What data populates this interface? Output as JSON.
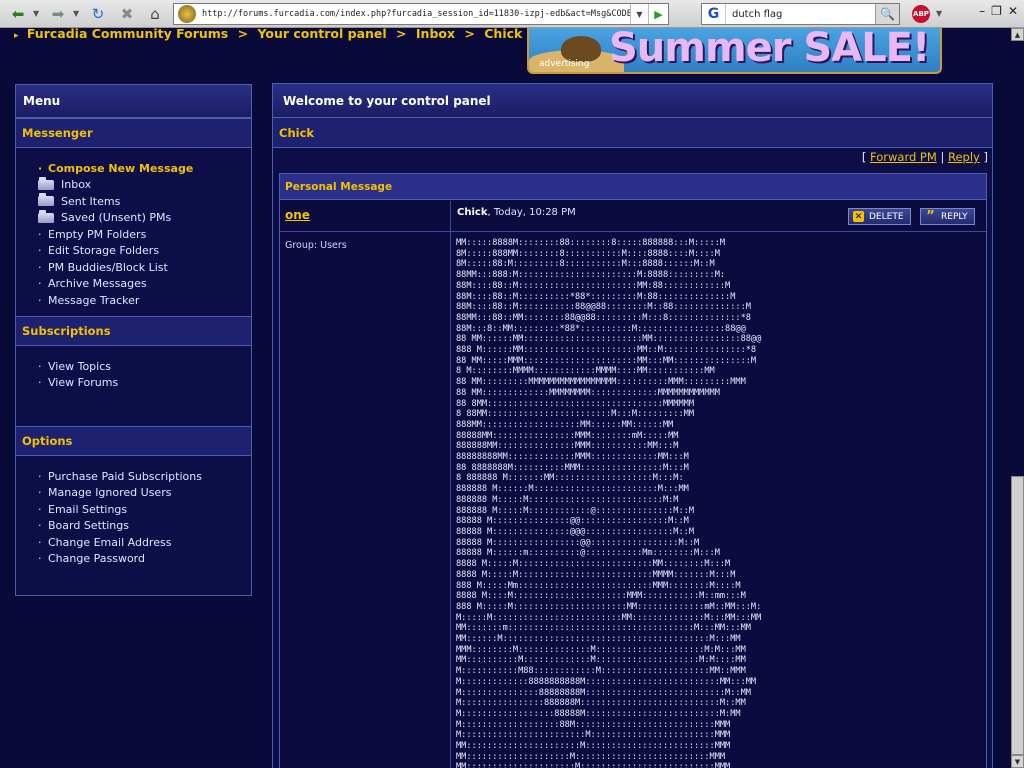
{
  "browser": {
    "url": "http://forums.furcadia.com/index.php?furcadia_session_id=11830-izpj-edb&act=Msg&CODE=",
    "search_value": "dutch flag",
    "search_engine_glyph": "G",
    "abp_label": "ABP"
  },
  "breadcrumb": [
    "Furcadia Community Forums",
    "Your control panel",
    "Inbox",
    "Chick"
  ],
  "breadcrumb_sep": ">",
  "banner": {
    "text": "Summer SALE!",
    "label": "advertising"
  },
  "sidebar": {
    "title": "Menu",
    "sections": [
      {
        "title": "Messenger",
        "items": [
          {
            "label": "Compose New Message",
            "type": "compose"
          },
          {
            "label": "Inbox",
            "type": "folder"
          },
          {
            "label": "Sent Items",
            "type": "folder"
          },
          {
            "label": "Saved (Unsent) PMs",
            "type": "folder"
          },
          {
            "label": "Empty PM Folders",
            "type": "link"
          },
          {
            "label": "Edit Storage Folders",
            "type": "link"
          },
          {
            "label": "PM Buddies/Block List",
            "type": "link"
          },
          {
            "label": "Archive Messages",
            "type": "link"
          },
          {
            "label": "Message Tracker",
            "type": "link"
          }
        ]
      },
      {
        "title": "Subscriptions",
        "items": [
          {
            "label": "View Topics",
            "type": "link"
          },
          {
            "label": "View Forums",
            "type": "link"
          }
        ]
      },
      {
        "title": "Options",
        "items": [
          {
            "label": "Purchase Paid Subscriptions",
            "type": "link"
          },
          {
            "label": "Manage Ignored Users",
            "type": "link"
          },
          {
            "label": "Email Settings",
            "type": "link"
          },
          {
            "label": "Board Settings",
            "type": "link"
          },
          {
            "label": "Change Email Address",
            "type": "link"
          },
          {
            "label": "Change Password",
            "type": "link"
          }
        ]
      }
    ]
  },
  "main": {
    "title": "Welcome to your control panel",
    "subtitle": "Chick",
    "actions": {
      "open": "[",
      "forward": "Forward PM",
      "sep": "|",
      "reply": "Reply",
      "close": "]"
    },
    "pm": {
      "box_title": "Personal Message",
      "author": "one",
      "from": "Chick",
      "date": ", Today, 10:28 PM",
      "delete_label": "DELETE",
      "reply_label": "REPLY",
      "group": "Group: Users",
      "body": "MM:::::8888M::::::::88::::::::8:::::888888:::M:::::M\n8M:::::888MM::::::::8:::::::::::M::::8888::::M::::M\n8M:::::88:M:::::::::8:::::::::::M:::8888::::::M::M\n88MM:::888:M:::::::::::::::::::::::M:8888:::::::::M:\n88M::::88::M:::::::::::::::::::::::MM:88::::::::::::M\n88M::::88::M::::::::::*88*:::::::::M:88::::::::::::::M\n88M::::88::M:::::::::::88@@88::::::::M::88::::::::::::::M\n88MM:::88::MM::::::::88@@88:::::::::M:::8::::::::::::::*8\n88M:::8::MM:::::::::*88*::::::::::M:::::::::::::::::88@@\n88 MM::::::MM:::::::::::::::::::::::MM:::::::::::::::::88@@\n888 M::::::MM::::::::::::::::::::::MM::M::::::::::::::::*8\n88 MM:::::MMM::::::::::::::::::::::MM:::MM:::::::::::::::M\n8 M::::::::MMMM::::::::::::MMMM::::MM:::::::::::MM\n88 MM:::::::::MMMMMMMMMMMMMMMMM::::::::::MMM:::::::::MMM\n88 MM:::::::::::::MMMMMMMM:::::::::::::MMMMMMMMMMMM\n88 8MM::::::::::::::::::::::::::::::::::MMMMMM\n8 88MM::::::::::::::::::::::::M:::M:::::::::MM\n888MM:::::::::::::::::::MM::::::MM::::::MM\n88888MM::::::::::::::::MMM::::::::mM:::::MM\n888888MM:::::::::::::::MMM:::::::::::MM:::M\n88888888MM:::::::::::::MMM:::::::::::::MM:::M\n88 8888888M::::::::::MMM::::::::::::::::M:::M\n8 888888 M:::::::MM:::::::::::::::::::M:::M:\n888888 M::::::M::::::::::::::::::::::::M:::MM\n888888 M:::::M::::::::::::::::::::::::::M:M\n888888 M:::::M::::::::::::@:::::::::::::::M::M\n88888 M:::::::::::::::@@:::::::::::::::::M::M\n88888 M:::::::::::::::@@@:::::::::::::::::M::M\n88888 M:::::::::::::::::@@:::::::::::::::::M::M\n88888 M::::::m::::::::::@:::::::::::Mm::::::::M:::M\n8888 M:::::M::::::::::::::::::::::::::MM::::::::M:::M\n8888 M:::::M::::::::::::::::::::::::::MMMM:::::::M:::M\n888 M:::::Mm::::::::::::::::::::::::::MMM::::::::M::::M\n8888 M::::M::::::::::::::::::::::MMM:::::::::::M::mm:::M\n888 M:::::M::::::::::::::::::::::MM:::::::::::::mM::MM:::M:\nM:::::M:::::::::::::::::::::::::MM::::::::::::::M:::MM:::MM\nMM:::::::m::::::::::::::::::::::::::::::::::::M:::MM:::MM\nMM::::::M::::::::::::::::::::::::::::::::::::::::M:::MM\nMMM::::::::M::::::::::::::M:::::::::::::::::::::M:M:::MM\nMM::::::::::M:::::::::::::M::::::::::::::::::::M:M::::MM\nM:::::::::::M88::::::::::::M:::::::::::::::::::::MM::MMM\nM:::::::::::::8888888888M::::::::::::::::::::::::::MM:::MM\nM:::::::::::::::88888888M:::::::::::::::::::::::::::M::MM\nM::::::::::::::::888888M:::::::::::::::::::::::::::M::MM\nM::::::::::::::::::88888M::::::::::::::::::::::::::M:MM\nM:::::::::::::::::::88M:::::::::::::::::::::::::::MMM\nM::::::::::::::::::::::::M::::::::::::::::::::::::MMM\nMM::::::::::::::::::::::M:::::::::::::::::::::::::MMM\nMM::::::::::::::::::::M::::::::::::::::::::::::::MMM\nMM:::::::::::::::::::::M::::::::::::::::::::::::::MMM\nMM:::::::::::::::::::::M::::::::::::::::::::::::::MMM\nMM::::::::::::::::::::M::::::::::::::::::::::::::MMM"
    }
  }
}
